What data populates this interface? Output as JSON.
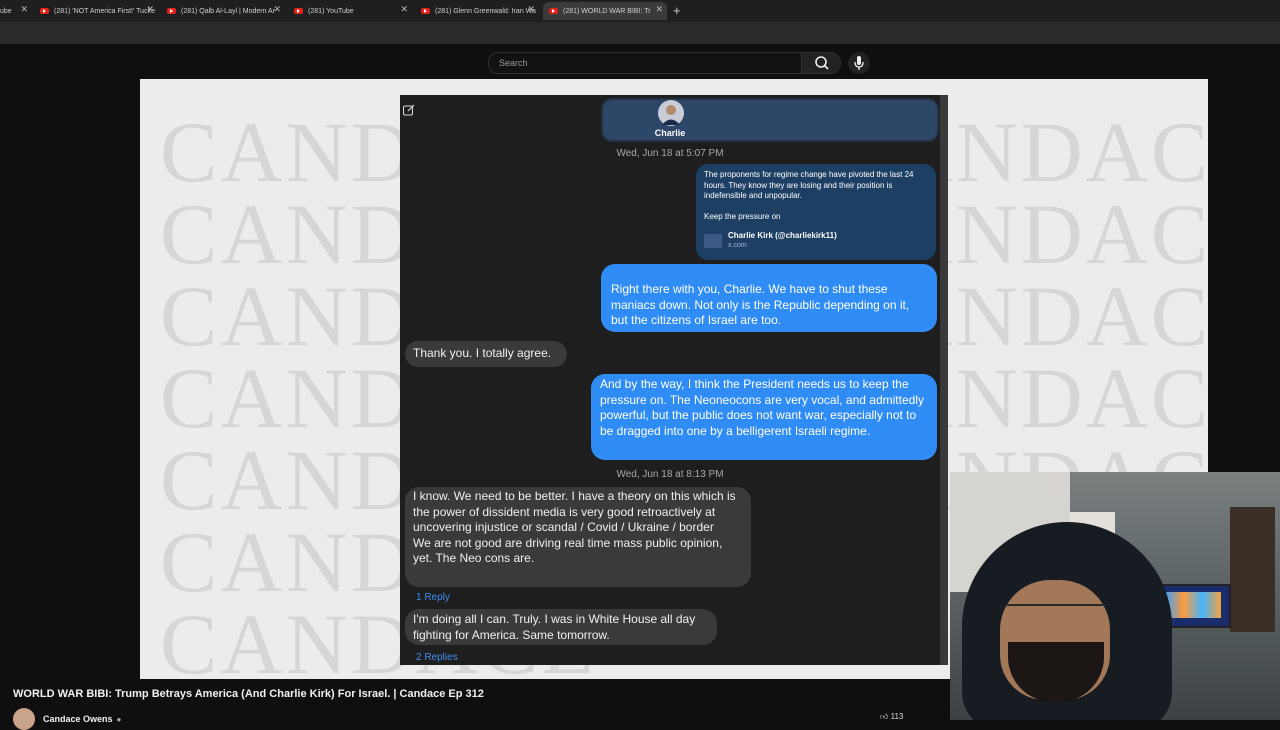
{
  "browser": {
    "tabs": [
      {
        "title": "ube",
        "active": false
      },
      {
        "title": "(281) 'NOT America First!' Tucke",
        "active": false
      },
      {
        "title": "(281) Qalb Al-Layl | Modern Ar",
        "active": false
      },
      {
        "title": "(281) YouTube",
        "active": false
      },
      {
        "title": "(281) Glenn Greenwald: Iran Wa",
        "active": false
      },
      {
        "title": "(281) WORLD WAR BIBI: Tr",
        "active": true
      }
    ],
    "new_tab": "+"
  },
  "header": {
    "search_placeholder": "Search"
  },
  "watermark_text": "CANDACE",
  "chat": {
    "contact_name": "Charlie",
    "timestamp_1": "Wed, Jun 18 at 5:07 PM",
    "link_message": "The proponents for regime change have pivoted the last 24 hours. They know they are losing and their position is indefensible and unpopular.\n\nKeep the pressure on",
    "link_title": "Charlie Kirk (@charliekirk11)",
    "link_domain": "x.com",
    "msg_1": "Right there with you, Charlie. We have to shut these maniacs down. Not only is the Republic depending on it, but the citizens of Israel are too.",
    "msg_2": "Thank you. I totally agree.",
    "msg_3": "And by the way, I think the President needs us to keep the pressure on. The Neoneocons are very vocal, and admittedly powerful, but the public does not want war, especially not to be dragged into one by a belligerent Israeli regime.",
    "timestamp_2": "Wed, Jun 18 at 8:13 PM",
    "msg_4": "I know. We need to be better. I have a theory on this which is the power of dissident media is very good retroactively at uncovering injustice or scandal / Covid / Ukraine / border\nWe are not good are driving real time mass public opinion, yet. The Neo cons are.",
    "reply_1": "1 Reply",
    "msg_5": "I'm doing all I can. Truly. I was in White House all day fighting for America. Same tomorrow.",
    "reply_2": "2 Replies"
  },
  "video": {
    "title": "WORLD WAR BIBI: Trump Betrays America (And Charlie Kirk) For Israel. | Candace Ep 312",
    "channel": "Candace Owens",
    "likes": "113"
  },
  "colors": {
    "imessage_blue": "#2f8cf5",
    "imessage_gray": "#3a3a3c",
    "youtube_red": "#e62117"
  }
}
